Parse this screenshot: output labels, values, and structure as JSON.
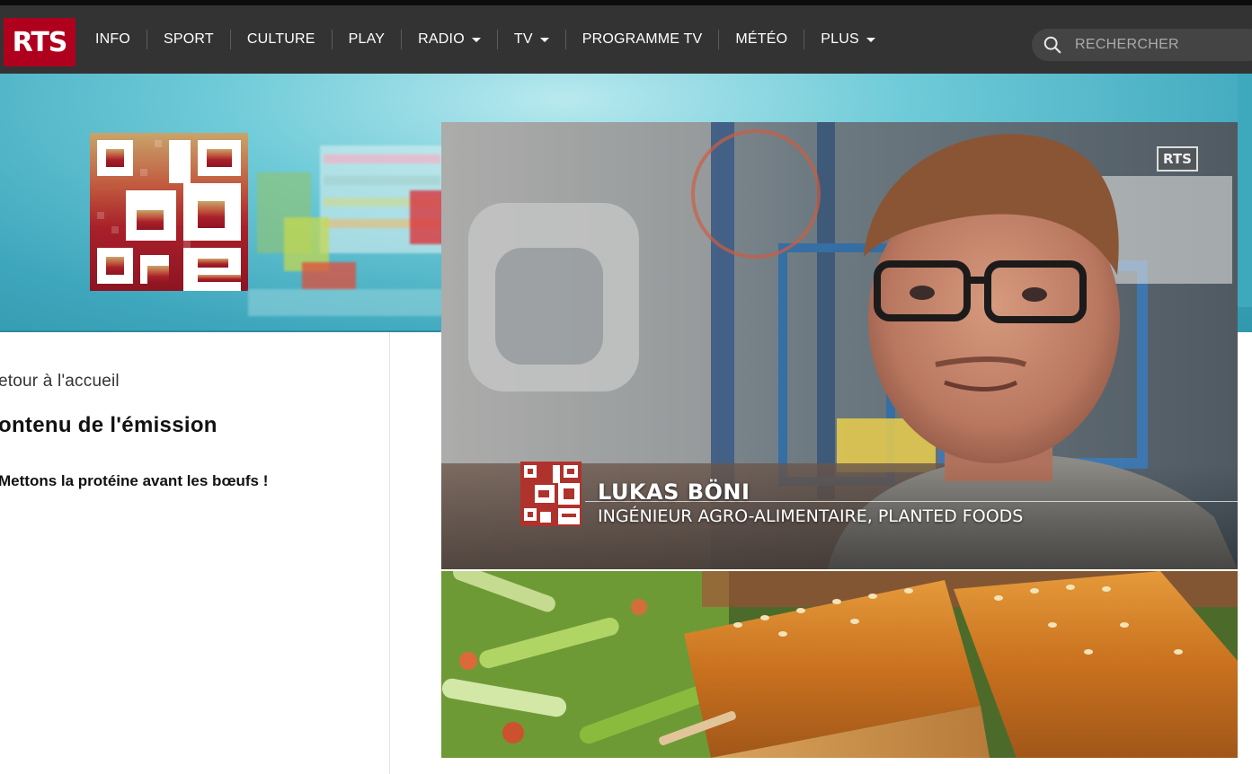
{
  "brand": {
    "logo_text": "RTS",
    "color": "#af001e"
  },
  "nav": {
    "items": [
      {
        "label": "INFO",
        "dropdown": false
      },
      {
        "label": "SPORT",
        "dropdown": false
      },
      {
        "label": "CULTURE",
        "dropdown": false
      },
      {
        "label": "PLAY",
        "dropdown": false
      },
      {
        "label": "RADIO",
        "dropdown": true
      },
      {
        "label": "TV",
        "dropdown": true
      },
      {
        "label": "PROGRAMME TV",
        "dropdown": false
      },
      {
        "label": "MÉTÉO",
        "dropdown": false
      },
      {
        "label": "PLUS",
        "dropdown": true
      }
    ]
  },
  "search": {
    "placeholder": "RECHERCHER",
    "icon": "search-icon"
  },
  "sidebar": {
    "back_label": "etour à l'accueil",
    "section_title": "ontenu de l'émission",
    "topic": "Mettons la protéine avant les bœufs !"
  },
  "video": {
    "watermark": "RTS",
    "person_name": "LUKAS BÖNI",
    "person_role": "INGÉNIEUR AGRO-ALIMENTAIRE, PLANTED FOODS"
  }
}
